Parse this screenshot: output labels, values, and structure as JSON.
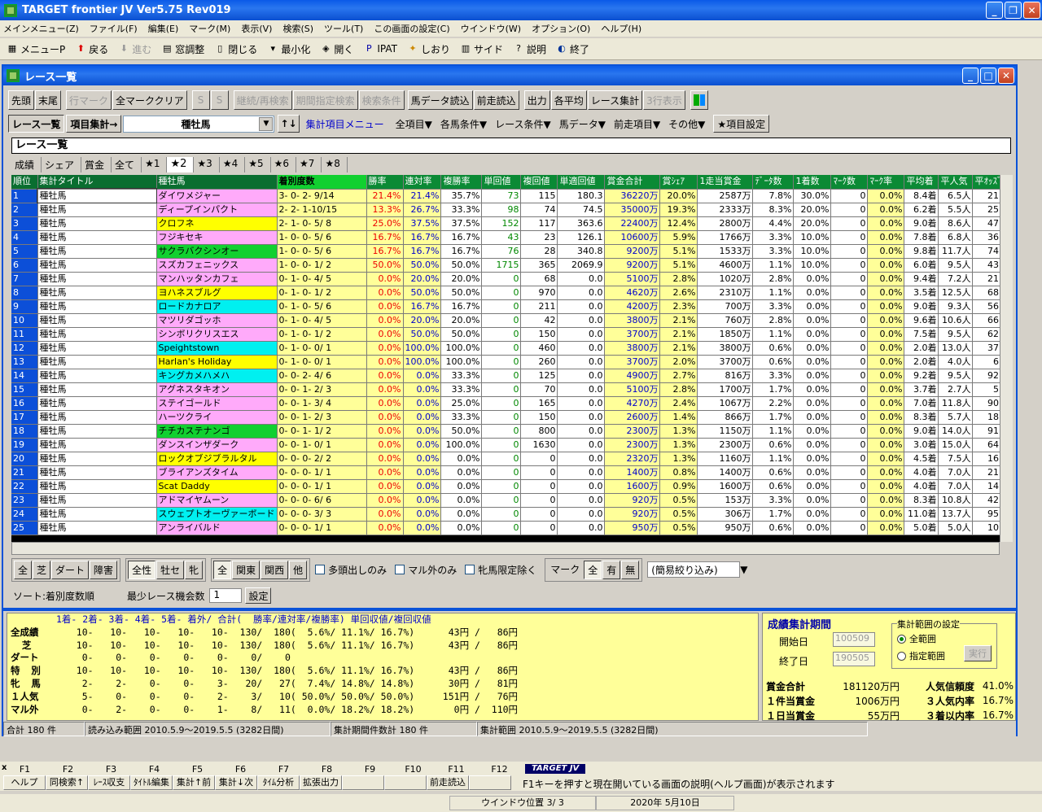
{
  "app": {
    "title": "TARGET frontier JV  Ver5.75  Rev019"
  },
  "menu": [
    "メインメニュー(Z)",
    "ファイル(F)",
    "編集(E)",
    "マーク(M)",
    "表示(V)",
    "検索(S)",
    "ツール(T)",
    "この画面の設定(C)",
    "ウインドウ(W)",
    "オプション(O)",
    "ヘルプ(H)"
  ],
  "toolbar": [
    {
      "icon": "menu-icon",
      "label": "メニューP"
    },
    {
      "icon": "arrow-up-icon",
      "label": "戻る"
    },
    {
      "icon": "arrow-down-icon",
      "label": "進む",
      "disabled": true
    },
    {
      "icon": "window-icon",
      "label": "窓調整"
    },
    {
      "icon": "door-icon",
      "label": "閉じる"
    },
    {
      "icon": "minimize-icon",
      "label": "最小化"
    },
    {
      "icon": "open-icon",
      "label": "開く"
    },
    {
      "icon": "ipat-icon",
      "label": "IPAT"
    },
    {
      "icon": "bookmark-icon",
      "label": "しおり"
    },
    {
      "icon": "side-icon",
      "label": "サイド"
    },
    {
      "icon": "help-icon",
      "label": "説明"
    },
    {
      "icon": "exit-icon",
      "label": "終了"
    }
  ],
  "inner": {
    "title": "レース一覧",
    "buttons": [
      {
        "l": "先頭"
      },
      {
        "l": "末尾"
      },
      {
        "l": "行マーク",
        "d": true
      },
      {
        "l": "全マーククリア"
      },
      {
        "l": "S",
        "d": true
      },
      {
        "l": "S",
        "d": true
      },
      {
        "l": "継続/再検索",
        "d": true
      },
      {
        "l": "期間指定検索",
        "d": true
      },
      {
        "l": "検索条件",
        "d": true
      },
      {
        "l": "馬データ読込"
      },
      {
        "l": "前走読込"
      },
      {
        "l": "出力"
      },
      {
        "l": "各平均"
      },
      {
        "l": "レース集計"
      },
      {
        "l": "3行表示",
        "d": true
      }
    ],
    "view1": "レース一覧",
    "view2": "項目集計→",
    "combo": "種牡馬",
    "menu2": [
      "集計項目メニュー",
      "全項目▼",
      "各馬条件▼",
      "レース条件▼",
      "馬データ▼",
      "前走項目▼",
      "その他▼"
    ],
    "item_setting": "★項目設定",
    "section_title": "レース一覧",
    "tabs": [
      "成績",
      "シェア",
      "賞金",
      "全て",
      "★1",
      "★2",
      "★3",
      "★4",
      "★5",
      "★6",
      "★7",
      "★8"
    ]
  },
  "grid": {
    "headers": [
      "順位",
      "集計タイトル",
      "種牡馬",
      "着別度数",
      "勝率",
      "連対率",
      "複勝率",
      "単回値",
      "複回値",
      "単適回値",
      "賞金合計",
      "賞ｼｪｱ",
      "1走当賞金",
      "ﾃﾞｰﾀ数",
      "1着数",
      "ﾏｰｸ数",
      "ﾏｰｸ率",
      "平均着",
      "平人気",
      "平ｵｯｽﾞ"
    ],
    "rows": [
      [
        "1",
        "種牡馬",
        "ダイワメジャー",
        "pk",
        "3- 0- 2- 9/14",
        "21.4%",
        "21.4%",
        "35.7%",
        "73",
        "115",
        "180.3",
        "36220万",
        "20.0%",
        "2587万",
        "7.8%",
        "30.0%",
        "0",
        "0.0%",
        "8.4着",
        "6.5人",
        "21."
      ],
      [
        "2",
        "種牡馬",
        "ディープインパクト",
        "pk",
        "2- 2- 1-10/15",
        "13.3%",
        "26.7%",
        "33.3%",
        "98",
        "74",
        "74.5",
        "35000万",
        "19.3%",
        "2333万",
        "8.3%",
        "20.0%",
        "0",
        "0.0%",
        "6.2着",
        "5.5人",
        "25."
      ],
      [
        "3",
        "種牡馬",
        "クロフネ",
        "ye",
        "2- 1- 0- 5/ 8",
        "25.0%",
        "37.5%",
        "37.5%",
        "152",
        "117",
        "363.6",
        "22400万",
        "12.4%",
        "2800万",
        "4.4%",
        "20.0%",
        "0",
        "0.0%",
        "9.0着",
        "8.6人",
        "47."
      ],
      [
        "4",
        "種牡馬",
        "フジキセキ",
        "pk",
        "1- 0- 0- 5/ 6",
        "16.7%",
        "16.7%",
        "16.7%",
        "43",
        "23",
        "126.1",
        "10600万",
        "5.9%",
        "1766万",
        "3.3%",
        "10.0%",
        "0",
        "0.0%",
        "7.8着",
        "6.8人",
        "36."
      ],
      [
        "5",
        "種牡馬",
        "サクラバクシンオー",
        "gr",
        "1- 0- 0- 5/ 6",
        "16.7%",
        "16.7%",
        "16.7%",
        "76",
        "28",
        "340.8",
        "9200万",
        "5.1%",
        "1533万",
        "3.3%",
        "10.0%",
        "0",
        "0.0%",
        "9.8着",
        "11.7人",
        "74."
      ],
      [
        "6",
        "種牡馬",
        "スズカフェニックス",
        "pk",
        "1- 0- 0- 1/ 2",
        "50.0%",
        "50.0%",
        "50.0%",
        "1715",
        "365",
        "2069.9",
        "9200万",
        "5.1%",
        "4600万",
        "1.1%",
        "10.0%",
        "0",
        "0.0%",
        "6.0着",
        "9.5人",
        "43."
      ],
      [
        "7",
        "種牡馬",
        "マンハッタンカフェ",
        "pk",
        "0- 1- 0- 4/ 5",
        "0.0%",
        "20.0%",
        "20.0%",
        "0",
        "68",
        "0.0",
        "5100万",
        "2.8%",
        "1020万",
        "2.8%",
        "0.0%",
        "0",
        "0.0%",
        "9.4着",
        "7.2人",
        "21."
      ],
      [
        "8",
        "種牡馬",
        "ヨハネスブルグ",
        "ye",
        "0- 1- 0- 1/ 2",
        "0.0%",
        "50.0%",
        "50.0%",
        "0",
        "970",
        "0.0",
        "4620万",
        "2.6%",
        "2310万",
        "1.1%",
        "0.0%",
        "0",
        "0.0%",
        "3.5着",
        "12.5人",
        "68."
      ],
      [
        "9",
        "種牡馬",
        "ロードカナロア",
        "cy",
        "0- 1- 0- 5/ 6",
        "0.0%",
        "16.7%",
        "16.7%",
        "0",
        "211",
        "0.0",
        "4200万",
        "2.3%",
        "700万",
        "3.3%",
        "0.0%",
        "0",
        "0.0%",
        "9.0着",
        "9.3人",
        "56."
      ],
      [
        "10",
        "種牡馬",
        "マツリダゴッホ",
        "pk",
        "0- 1- 0- 4/ 5",
        "0.0%",
        "20.0%",
        "20.0%",
        "0",
        "42",
        "0.0",
        "3800万",
        "2.1%",
        "760万",
        "2.8%",
        "0.0%",
        "0",
        "0.0%",
        "9.6着",
        "10.6人",
        "66."
      ],
      [
        "11",
        "種牡馬",
        "シンボリクリスエス",
        "pk",
        "0- 1- 0- 1/ 2",
        "0.0%",
        "50.0%",
        "50.0%",
        "0",
        "150",
        "0.0",
        "3700万",
        "2.1%",
        "1850万",
        "1.1%",
        "0.0%",
        "0",
        "0.0%",
        "7.5着",
        "9.5人",
        "62."
      ],
      [
        "12",
        "種牡馬",
        "Speightstown",
        "cy",
        "0- 1- 0- 0/ 1",
        "0.0%",
        "100.0%",
        "100.0%",
        "0",
        "460",
        "0.0",
        "3800万",
        "2.1%",
        "3800万",
        "0.6%",
        "0.0%",
        "0",
        "0.0%",
        "2.0着",
        "13.0人",
        "37."
      ],
      [
        "13",
        "種牡馬",
        "Harlan's Holiday",
        "ye",
        "0- 1- 0- 0/ 1",
        "0.0%",
        "100.0%",
        "100.0%",
        "0",
        "260",
        "0.0",
        "3700万",
        "2.0%",
        "3700万",
        "0.6%",
        "0.0%",
        "0",
        "0.0%",
        "2.0着",
        "4.0人",
        "6."
      ],
      [
        "14",
        "種牡馬",
        "キングカメハメハ",
        "cy",
        "0- 0- 2- 4/ 6",
        "0.0%",
        "0.0%",
        "33.3%",
        "0",
        "125",
        "0.0",
        "4900万",
        "2.7%",
        "816万",
        "3.3%",
        "0.0%",
        "0",
        "0.0%",
        "9.2着",
        "9.5人",
        "92."
      ],
      [
        "15",
        "種牡馬",
        "アグネスタキオン",
        "pk",
        "0- 0- 1- 2/ 3",
        "0.0%",
        "0.0%",
        "33.3%",
        "0",
        "70",
        "0.0",
        "5100万",
        "2.8%",
        "1700万",
        "1.7%",
        "0.0%",
        "0",
        "0.0%",
        "3.7着",
        "2.7人",
        "5."
      ],
      [
        "16",
        "種牡馬",
        "ステイゴールド",
        "pk",
        "0- 0- 1- 3/ 4",
        "0.0%",
        "0.0%",
        "25.0%",
        "0",
        "165",
        "0.0",
        "4270万",
        "2.4%",
        "1067万",
        "2.2%",
        "0.0%",
        "0",
        "0.0%",
        "7.0着",
        "11.8人",
        "90."
      ],
      [
        "17",
        "種牡馬",
        "ハーツクライ",
        "pk",
        "0- 0- 1- 2/ 3",
        "0.0%",
        "0.0%",
        "33.3%",
        "0",
        "150",
        "0.0",
        "2600万",
        "1.4%",
        "866万",
        "1.7%",
        "0.0%",
        "0",
        "0.0%",
        "8.3着",
        "5.7人",
        "18."
      ],
      [
        "18",
        "種牡馬",
        "チチカステナンゴ",
        "gr",
        "0- 0- 1- 1/ 2",
        "0.0%",
        "0.0%",
        "50.0%",
        "0",
        "800",
        "0.0",
        "2300万",
        "1.3%",
        "1150万",
        "1.1%",
        "0.0%",
        "0",
        "0.0%",
        "9.0着",
        "14.0人",
        "91."
      ],
      [
        "19",
        "種牡馬",
        "ダンスインザダーク",
        "pk",
        "0- 0- 1- 0/ 1",
        "0.0%",
        "0.0%",
        "100.0%",
        "0",
        "1630",
        "0.0",
        "2300万",
        "1.3%",
        "2300万",
        "0.6%",
        "0.0%",
        "0",
        "0.0%",
        "3.0着",
        "15.0人",
        "64."
      ],
      [
        "20",
        "種牡馬",
        "ロックオブジブラルタル",
        "ye",
        "0- 0- 0- 2/ 2",
        "0.0%",
        "0.0%",
        "0.0%",
        "0",
        "0",
        "0.0",
        "2320万",
        "1.3%",
        "1160万",
        "1.1%",
        "0.0%",
        "0",
        "0.0%",
        "4.5着",
        "7.5人",
        "16."
      ],
      [
        "21",
        "種牡馬",
        "ブライアンズタイム",
        "pk",
        "0- 0- 0- 1/ 1",
        "0.0%",
        "0.0%",
        "0.0%",
        "0",
        "0",
        "0.0",
        "1400万",
        "0.8%",
        "1400万",
        "0.6%",
        "0.0%",
        "0",
        "0.0%",
        "4.0着",
        "7.0人",
        "21."
      ],
      [
        "22",
        "種牡馬",
        "Scat Daddy",
        "ye",
        "0- 0- 0- 1/ 1",
        "0.0%",
        "0.0%",
        "0.0%",
        "0",
        "0",
        "0.0",
        "1600万",
        "0.9%",
        "1600万",
        "0.6%",
        "0.0%",
        "0",
        "0.0%",
        "4.0着",
        "7.0人",
        "14."
      ],
      [
        "23",
        "種牡馬",
        "アドマイヤムーン",
        "pk",
        "0- 0- 0- 6/ 6",
        "0.0%",
        "0.0%",
        "0.0%",
        "0",
        "0",
        "0.0",
        "920万",
        "0.5%",
        "153万",
        "3.3%",
        "0.0%",
        "0",
        "0.0%",
        "8.3着",
        "10.8人",
        "42."
      ],
      [
        "24",
        "種牡馬",
        "スウェプトオーヴァーボード",
        "cy",
        "0- 0- 0- 3/ 3",
        "0.0%",
        "0.0%",
        "0.0%",
        "0",
        "0",
        "0.0",
        "920万",
        "0.5%",
        "306万",
        "1.7%",
        "0.0%",
        "0",
        "0.0%",
        "11.0着",
        "13.7人",
        "95."
      ],
      [
        "25",
        "種牡馬",
        "アンライバルド",
        "pk",
        "0- 0- 0- 1/ 1",
        "0.0%",
        "0.0%",
        "0.0%",
        "0",
        "0",
        "0.0",
        "950万",
        "0.5%",
        "950万",
        "0.6%",
        "0.0%",
        "0",
        "0.0%",
        "5.0着",
        "5.0人",
        "10."
      ]
    ]
  },
  "filters": {
    "g1": [
      "全",
      "芝",
      "ダート",
      "障害"
    ],
    "g2": [
      "全性",
      "牡セ",
      "牝"
    ],
    "g3": [
      "全",
      "関東",
      "関西",
      "他"
    ],
    "cb": [
      "多頭出しのみ",
      "マル外のみ",
      "牝馬限定除く"
    ],
    "mark_label": "マーク",
    "g4": [
      "全",
      "有",
      "無"
    ],
    "simple": "(簡易絞り込み)"
  },
  "sort": {
    "label": "ソート:着別度数順",
    "min_label": "最少レース機会数",
    "min_value": "1",
    "set_btn": "設定"
  },
  "stats": {
    "header": "1着- 2着- 3着- 4着- 5着- 着外/ 合計(  勝率/連対率/複勝率) 単回収値/複回収値",
    "rows": [
      {
        "l": "全成績",
        "v": "   10-   10-   10-   10-   10-  130/  180(  5.6%/ 11.1%/ 16.7%)      43円 /   86円"
      },
      {
        "l": "  芝",
        "v": "   10-   10-   10-   10-   10-  130/  180(  5.6%/ 11.1%/ 16.7%)      43円 /   86円"
      },
      {
        "l": "ダート",
        "v": "    0-    0-    0-    0-    0-    0/    0"
      },
      {
        "l": "特  別",
        "v": "   10-   10-   10-   10-   10-  130/  180(  5.6%/ 11.1%/ 16.7%)      43円 /   86円"
      },
      {
        "l": "牝  馬",
        "v": "    2-    2-    0-    0-    3-   20/   27(  7.4%/ 14.8%/ 14.8%)      30円 /   81円"
      },
      {
        "l": "１人気",
        "v": "    5-    0-    0-    0-    2-    3/   10( 50.0%/ 50.0%/ 50.0%)     151円 /   76円"
      },
      {
        "l": "マル外",
        "v": "    0-    2-    0-    0-    1-    8/   11(  0.0%/ 18.2%/ 18.2%)       0円 /  110円"
      }
    ]
  },
  "period": {
    "title": "成績集計期間",
    "start_label": "開始日",
    "start_val": "100509",
    "end_label": "終了日",
    "end_val": "190505",
    "range_title": "集計範囲の設定",
    "opt1": "全範囲",
    "opt2": "指定範囲",
    "exec": "実行",
    "summary": [
      [
        "賞金合計",
        "181120万円",
        "人気信頼度",
        "41.0%"
      ],
      [
        "１件当賞金",
        "1006万円",
        "３人気内率",
        "16.7%"
      ],
      [
        "１日当賞金",
        "55万円",
        "３着以内率",
        "16.7%"
      ]
    ]
  },
  "status": [
    "合計 180 件",
    "読み込み範囲 2010.5.9～2019.5.5 (3282日間)",
    "集計期間件数計 180 件",
    "集計範囲 2010.5.9～2019.5.5 (3282日間)"
  ],
  "fkeys": {
    "labels": [
      "F1",
      "F2",
      "F3",
      "F4",
      "F5",
      "F6",
      "F7",
      "F8",
      "F9",
      "F10",
      "F11",
      "F12"
    ],
    "btns": [
      "ヘルプ",
      "同検索↑",
      "ﾚｰｽ収支",
      "ﾀｲﾄﾙ編集",
      "集計↑前",
      "集計↓次",
      "ﾀｲﾑ分析",
      "拡張出力",
      "",
      "",
      "前走読込",
      ""
    ],
    "logo": "TARGET JV",
    "hint": "F1キーを押すと現在開いている画面の説明(ヘルプ画面)が表示されます"
  },
  "bottom": {
    "pos": "ウインドウ位置 3/ 3",
    "date": "2020年 5月10日"
  }
}
